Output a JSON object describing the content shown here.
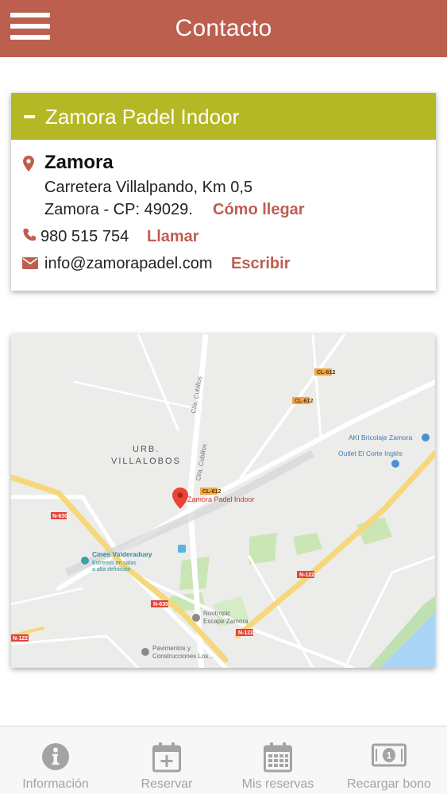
{
  "header": {
    "title": "Contacto"
  },
  "card": {
    "title": "Zamora Padel Indoor",
    "city": "Zamora",
    "address_line1": "Carretera Villalpando, Km 0,5",
    "address_line2": "Zamora - CP: 49029.",
    "directions_label": "Cómo llegar",
    "phone": "980 515 754",
    "call_label": "Llamar",
    "email": "info@zamorapadel.com",
    "write_label": "Escribir"
  },
  "map": {
    "place_marker": "Zamora Padel Indoor",
    "labels": {
      "urb1": "URB.",
      "urb2": "VILLALOBOS",
      "aki": "AKI Bricolaje Zamora",
      "outlet": "Outlet El Corte Inglés",
      "cines": "Cines Valderaduey",
      "cines_sub1": "Estrenos en salas",
      "cines_sub2": "a alta definición",
      "nootropic1": "Nootropic",
      "nootropic2": "Escape Zamora",
      "pav1": "Pavimentos y",
      "pav2": "Construcciones Los...",
      "cl612a": "CL-612",
      "cl612b": "CL-612",
      "cl612c": "CL-612",
      "n630a": "N-630",
      "n630b": "N-630",
      "n122a": "N-122",
      "n122b": "N-122",
      "n122c": "N-122",
      "cuba1": "Cl/a. Cubillos",
      "cuba2": "Cl/a. Cubillos"
    },
    "colors": {
      "land": "#ececea",
      "road": "#ffffff",
      "highway": "#f6d77a",
      "park": "#c9e6b4",
      "water": "#a9d4f5",
      "pin": "#e94335"
    }
  },
  "tabs": [
    {
      "label": "Información",
      "icon": "info-icon"
    },
    {
      "label": "Reservar",
      "icon": "calendar-plus-icon"
    },
    {
      "label": "Mis reservas",
      "icon": "calendar-grid-icon"
    },
    {
      "label": "Recargar bono",
      "icon": "banknote-icon"
    }
  ],
  "colors": {
    "header": "#bd5f4f",
    "card_head": "#b4b825",
    "link": "#bd5f4f",
    "tab_inactive": "#a3a3a3"
  }
}
